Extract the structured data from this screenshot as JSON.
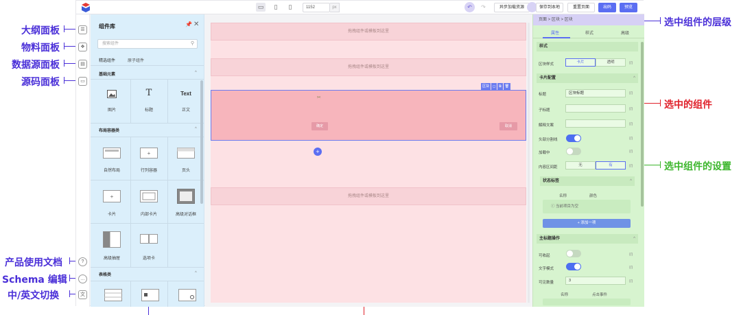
{
  "annotations": {
    "outline": "大纲面板",
    "material": "物料面板",
    "datasource": "数据源面板",
    "sourcecode": "源码面板",
    "docs": "产品使用文档",
    "schema": "Schema 编辑",
    "lang": "中/英文切换",
    "hierarchy": "选中组件的层级",
    "selected": "选中的组件",
    "settings": "选中组件的设置"
  },
  "colors": {
    "accent": "#5b6ef2",
    "annotation_purple": "#4a2fd8",
    "annotation_red": "#e0202a",
    "annotation_green": "#3cb62c"
  },
  "topbar": {
    "width_value": "1152",
    "width_unit": "px",
    "btn_async": "异步加载资源",
    "btn_save_local": "保存到本地",
    "btn_reset": "重置页面",
    "btn_preview": "出码",
    "btn_save": "预览"
  },
  "library": {
    "title": "组件库",
    "search_placeholder": "搜索组件",
    "tab_featured": "精选组件",
    "tab_other": "原子组件",
    "section_basic": "基础元素",
    "section_layout": "布局容器类",
    "section_table": "表格类",
    "items_basic": [
      "图片",
      "标题",
      "正文"
    ],
    "icon_text_title": "T",
    "icon_text_body": "Text",
    "items_layout_1": [
      "自然布局",
      "行列容器",
      "页头"
    ],
    "items_layout_2": [
      "卡片",
      "内部卡片",
      "高级对话框"
    ],
    "items_layout_3": [
      "高级抽屉",
      "选项卡"
    ]
  },
  "canvas": {
    "drop_hint": "拖拽组件或模板到这里",
    "card_ok": "确定",
    "card_cancel": "取消",
    "sel_tool_label": "区块"
  },
  "settings": {
    "breadcrumb": "页面 > 区块 > 区块",
    "tab_props": "属性",
    "tab_style": "样式",
    "tab_advanced": "高级",
    "sec_style": "样式",
    "block_style_label": "区块样式",
    "block_style_card": "卡片",
    "block_style_transparent": "透明",
    "sec_card": "卡片配置",
    "title_label": "标题",
    "title_value": "区块标题",
    "subtitle_label": "子标题",
    "explain_label": "解释文案",
    "header_divider_label": "头部分割线",
    "loading_label": "加载中",
    "padding_label": "内容区间距",
    "padding_none": "无",
    "padding_has": "有",
    "sec_status_tag": "状态标签",
    "col_name": "名称",
    "col_color": "颜色",
    "empty_hint": "当前项目为空",
    "add_item": "+ 添加一项",
    "sec_main_action": "主标题操作",
    "collapsible_label": "可收起",
    "text_mode_label": "文字模式",
    "visible_count_label": "可见数量",
    "visible_count_value": "3",
    "col_name2": "名称",
    "col_event": "点击事件",
    "fx": "{/}"
  }
}
